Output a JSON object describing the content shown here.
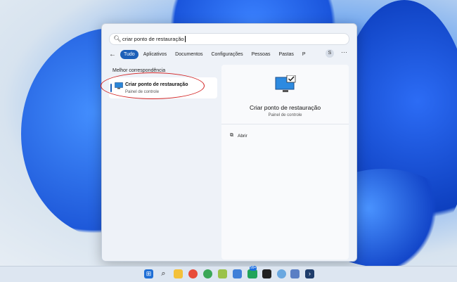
{
  "search": {
    "query": "criar ponto de restauração"
  },
  "filters": {
    "back": "←",
    "tabs": [
      {
        "label": "Tudo",
        "active": true
      },
      {
        "label": "Aplicativos",
        "active": false
      },
      {
        "label": "Documentos",
        "active": false
      },
      {
        "label": "Configurações",
        "active": false
      },
      {
        "label": "Pessoas",
        "active": false
      },
      {
        "label": "Pastas",
        "active": false
      },
      {
        "label": "P",
        "active": false
      }
    ],
    "avatar": "S",
    "more": "···"
  },
  "results": {
    "section_label": "Melhor correspondência",
    "best_match": {
      "title": "Criar ponto de restauração",
      "subtitle": "Painel de controle"
    }
  },
  "detail": {
    "title": "Criar ponto de restauração",
    "subtitle": "Painel de controle",
    "actions": [
      {
        "label": "Abrir",
        "icon": "open-external-icon"
      }
    ]
  },
  "taskbar": {
    "badge": "99+"
  },
  "colors": {
    "accent": "#1c5fb8",
    "highlight_oval": "#d22020"
  }
}
